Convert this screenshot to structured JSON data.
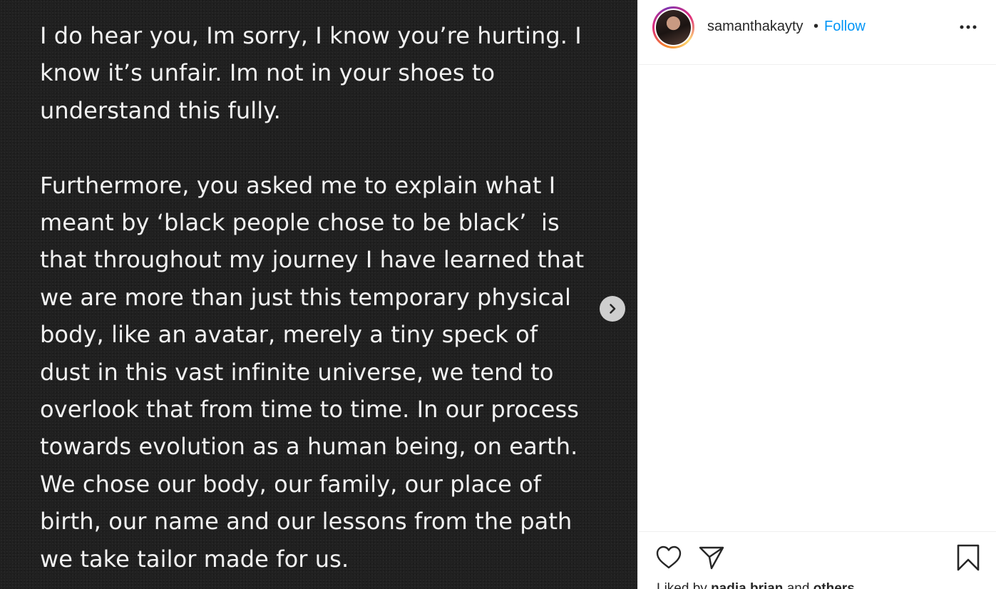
{
  "post": {
    "note_lines": [
      "I do hear you, Im sorry, I know you’re hurting. I",
      "know it’s unfair. Im not in your shoes to",
      "understand this fully.",
      "",
      "Furthermore, you asked me to explain what I",
      "meant by ‘black people chose to be black’  is",
      "that throughout my journey I have learned that",
      "we are more than just this temporary physical",
      "body, like an avatar, merely a tiny speck of",
      "dust in this vast infinite universe, we tend to",
      "overlook that from time to time. In our process",
      "towards evolution as a human being, on earth.",
      "We chose our body, our family, our place of",
      "birth, our name and our lessons from the path",
      "we take tailor made for us."
    ],
    "next_icon": "chevron-right-icon"
  },
  "header": {
    "username": "samanthakayty",
    "separator": "•",
    "follow_label": "Follow",
    "follow_color": "#0095f6",
    "more_icon": "more-options-icon"
  },
  "actions": {
    "like_icon": "heart-icon",
    "share_icon": "paper-plane-icon",
    "save_icon": "bookmark-icon",
    "liked_by_prefix": "Liked by",
    "liked_by_user": "nadia.brian",
    "liked_by_conj": "and",
    "liked_by_others": "others"
  }
}
